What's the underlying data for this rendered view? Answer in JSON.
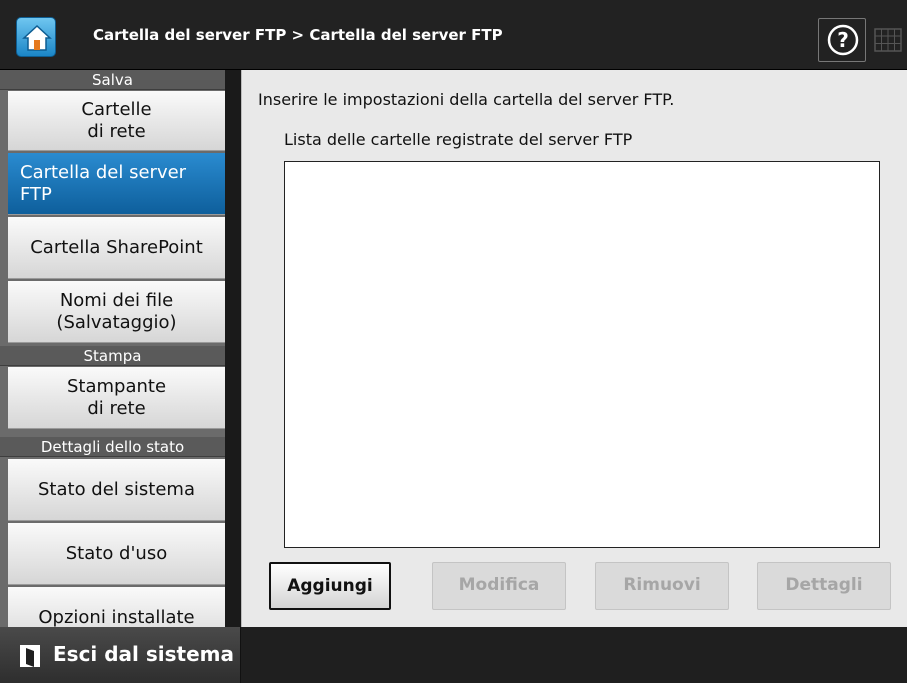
{
  "header": {
    "breadcrumb": "Cartella del server FTP > Cartella del server FTP"
  },
  "sidebar": {
    "sections": [
      {
        "label": "Salva"
      },
      {
        "label": "Stampa"
      },
      {
        "label": "Dettagli dello stato"
      }
    ],
    "items": [
      {
        "line1": "Cartelle",
        "line2": "di rete"
      },
      {
        "line1": "Cartella del server",
        "line2": "FTP"
      },
      {
        "line1": "Cartella SharePoint",
        "line2": ""
      },
      {
        "line1": "Nomi dei file",
        "line2": "(Salvataggio)"
      },
      {
        "line1": "Stampante",
        "line2": "di rete"
      },
      {
        "line1": "Stato del sistema",
        "line2": ""
      },
      {
        "line1": "Stato d'uso",
        "line2": ""
      },
      {
        "line1": "Opzioni installate",
        "line2": ""
      }
    ]
  },
  "main": {
    "instruction": "Inserire le impostazioni della cartella del server FTP.",
    "list_label": "Lista delle cartelle registrate del server FTP",
    "buttons": {
      "add": "Aggiungi",
      "edit": "Modifica",
      "remove": "Rimuovi",
      "details": "Dettagli"
    }
  },
  "footer": {
    "logout": "Esci dal sistema"
  },
  "colors": {
    "accent": "#0e5f9c",
    "header_bg": "#222222",
    "sidebar_bg": "#6b6b6b"
  }
}
